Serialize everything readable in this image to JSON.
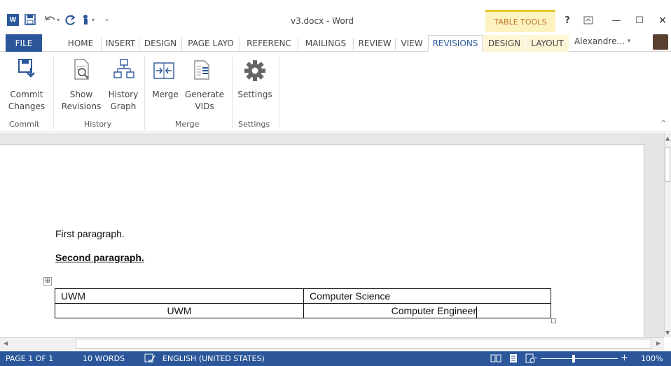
{
  "window": {
    "title": "v3.docx - Word",
    "contextual_group": "TABLE TOOLS",
    "help": "?",
    "ribbon_display_icon": "ribbon-display-options-icon",
    "minimize": "—",
    "maximize": "☐",
    "close": "✕"
  },
  "qat": {
    "app_logo": "W",
    "save_icon": "save-icon",
    "undo_icon": "undo-icon",
    "redo_icon": "redo-icon",
    "touch_mode_icon": "touch-mode-icon",
    "customize_icon": "customize-qat-icon"
  },
  "tabs": [
    {
      "label": "FILE"
    },
    {
      "label": "HOME"
    },
    {
      "label": "INSERT"
    },
    {
      "label": "DESIGN"
    },
    {
      "label": "PAGE LAYO"
    },
    {
      "label": "REFERENC"
    },
    {
      "label": "MAILINGS"
    },
    {
      "label": "REVIEW"
    },
    {
      "label": "VIEW"
    },
    {
      "label": "REVISIONS"
    },
    {
      "label": "DESIGN"
    },
    {
      "label": "LAYOUT"
    }
  ],
  "user": {
    "name": "Alexandre..."
  },
  "ribbon": {
    "commit_changes": {
      "line1": "Commit",
      "line2": "Changes"
    },
    "show_revisions": {
      "line1": "Show",
      "line2": "Revisions"
    },
    "history_graph": {
      "line1": "History",
      "line2": "Graph"
    },
    "merge": {
      "line1": "Merge"
    },
    "generate_vids": {
      "line1": "Generate",
      "line2": "VIDs"
    },
    "settings": {
      "line1": "Settings"
    },
    "groups": {
      "commit": "Commit",
      "history": "History",
      "merge": "Merge",
      "settings": "Settings"
    },
    "collapse": "^"
  },
  "document": {
    "paragraph1": "First paragraph.",
    "paragraph2": "Second paragraph.",
    "table": [
      [
        "UWM",
        "Computer Science"
      ],
      [
        "UWM",
        "Computer Engineer"
      ]
    ],
    "move_handle": "⊕"
  },
  "statusbar": {
    "page": "PAGE 1 OF 1",
    "words": "10 WORDS",
    "language": "ENGLISH (UNITED STATES)",
    "zoom": "100%",
    "zoom_minus": "-",
    "zoom_plus": "+"
  },
  "colors": {
    "accent": "#2b579a",
    "contextual": "#c0752b"
  }
}
